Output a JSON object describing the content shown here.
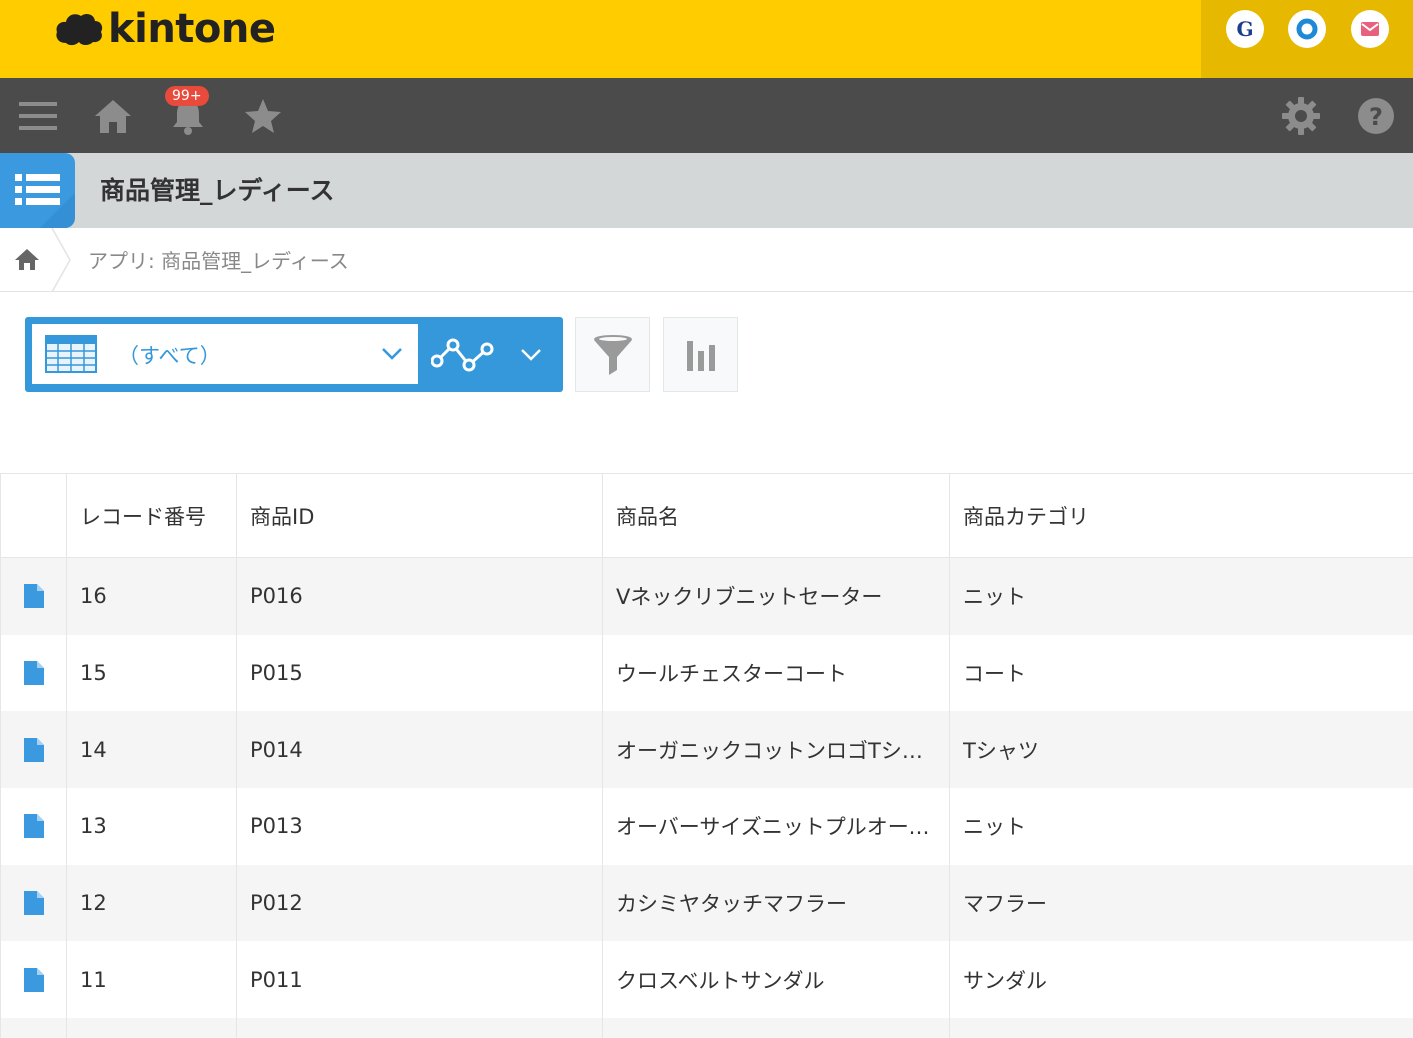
{
  "header": {
    "logo_text": "kintone",
    "brand_color": "#ffcc00",
    "nav_color": "#4b4b4b",
    "notification_badge": "99+"
  },
  "app": {
    "title": "商品管理_レディース",
    "accent_color": "#3498db"
  },
  "breadcrumb": {
    "text": "アプリ: 商品管理_レディース"
  },
  "toolbar": {
    "view_label": "（すべて）"
  },
  "table": {
    "columns": [
      "",
      "レコード番号",
      "商品ID",
      "商品名",
      "商品カテゴリ"
    ],
    "rows": [
      {
        "record_no": "16",
        "product_id": "P016",
        "product_name": "Vネックリブニットセーター",
        "category": "ニット"
      },
      {
        "record_no": "15",
        "product_id": "P015",
        "product_name": "ウールチェスターコート",
        "category": "コート"
      },
      {
        "record_no": "14",
        "product_id": "P014",
        "product_name": "オーガニックコットンロゴTシャツ",
        "category": "Tシャツ"
      },
      {
        "record_no": "13",
        "product_id": "P013",
        "product_name": "オーバーサイズニットプルオーバー",
        "category": "ニット"
      },
      {
        "record_no": "12",
        "product_id": "P012",
        "product_name": "カシミヤタッチマフラー",
        "category": "マフラー"
      },
      {
        "record_no": "11",
        "product_id": "P011",
        "product_name": "クロスベルトサンダル",
        "category": "サンダル"
      }
    ]
  }
}
